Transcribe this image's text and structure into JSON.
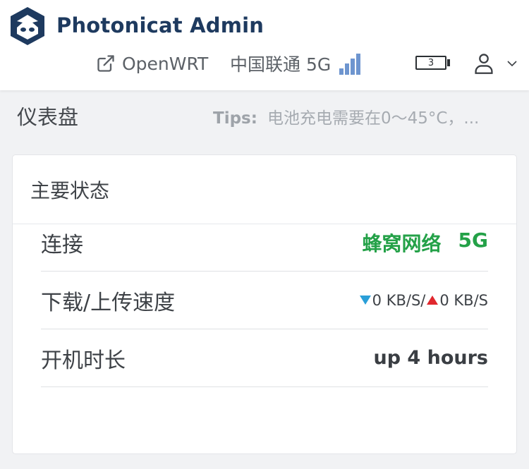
{
  "brand": {
    "name": "Photonicat Admin"
  },
  "toolbar": {
    "openwrt_label": "OpenWRT",
    "carrier": "中国联通 5G",
    "battery_level": "3",
    "signal_bars": 4
  },
  "page": {
    "title": "仪表盘",
    "tips_label": "Tips:",
    "tips_text": "电池充电需要在0～45°C，..."
  },
  "status_card": {
    "title": "主要状态",
    "rows": [
      {
        "label": "连接",
        "network": "蜂窝网络",
        "generation": "5G"
      },
      {
        "label": "下载/上传速度",
        "download": "0 KB/S/",
        "upload": "0 KB/S"
      },
      {
        "label": "开机时长",
        "value": "up 4 hours"
      }
    ]
  },
  "colors": {
    "brand": "#1e3a5f",
    "connected": "#24a148",
    "download_arrow": "#2a9fd8",
    "upload_arrow": "#e0282e",
    "signal": "#6e95cf"
  },
  "icons": {
    "logo": "cat-face-logo",
    "external": "external-link-icon",
    "signal": "signal-bars-icon",
    "battery": "battery-icon",
    "user": "user-icon",
    "chevron": "chevron-down-icon"
  }
}
